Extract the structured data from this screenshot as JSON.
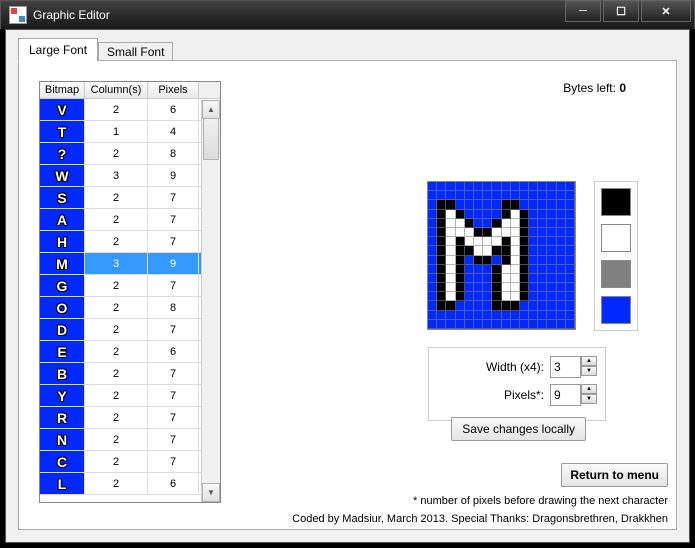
{
  "window": {
    "title": "Graphic Editor"
  },
  "tabs": {
    "large": "Large Font",
    "small": "Small Font"
  },
  "grid": {
    "headers": {
      "bitmap": "Bitmap",
      "columns": "Column(s)",
      "pixels": "Pixels"
    },
    "rows": [
      {
        "glyph": "V",
        "cols": "2",
        "px": "6"
      },
      {
        "glyph": "T",
        "cols": "1",
        "px": "4"
      },
      {
        "glyph": "?",
        "cols": "2",
        "px": "8"
      },
      {
        "glyph": "W",
        "cols": "3",
        "px": "9"
      },
      {
        "glyph": "S",
        "cols": "2",
        "px": "7"
      },
      {
        "glyph": "A",
        "cols": "2",
        "px": "7"
      },
      {
        "glyph": "H",
        "cols": "2",
        "px": "7"
      },
      {
        "glyph": "M",
        "cols": "3",
        "px": "9"
      },
      {
        "glyph": "G",
        "cols": "2",
        "px": "7"
      },
      {
        "glyph": "O",
        "cols": "2",
        "px": "8"
      },
      {
        "glyph": "D",
        "cols": "2",
        "px": "7"
      },
      {
        "glyph": "E",
        "cols": "2",
        "px": "6"
      },
      {
        "glyph": "B",
        "cols": "2",
        "px": "7"
      },
      {
        "glyph": "Y",
        "cols": "2",
        "px": "7"
      },
      {
        "glyph": "R",
        "cols": "2",
        "px": "7"
      },
      {
        "glyph": "N",
        "cols": "2",
        "px": "7"
      },
      {
        "glyph": "C",
        "cols": "2",
        "px": "7"
      },
      {
        "glyph": "L",
        "cols": "2",
        "px": "6"
      }
    ],
    "selected_index": 7
  },
  "bytes_left": {
    "label": "Bytes left: ",
    "value": "0"
  },
  "palette": {
    "colors": [
      "black",
      "white",
      "gray",
      "blue"
    ]
  },
  "controls": {
    "width_label": "Width (x4):",
    "width_value": "3",
    "pixels_label": "Pixels*:",
    "pixels_value": "9",
    "save": "Save changes locally"
  },
  "return_label": "Return to menu",
  "footnote": "* number of pixels before drawing the next character",
  "credits": "Coded by Madsiur, March 2013. Special Thanks: Dragonsbrethren, Drakkhen",
  "chart_data": {
    "type": "bitmap",
    "width": 16,
    "height": 16,
    "legend": {
      "l": "blue",
      "b": "black",
      "w": "white"
    },
    "pixels": [
      "llllllllllllllll",
      "llllllllllllllll",
      "lbblllllbblllllll",
      "lbwbllllbwblllll",
      "lbwwbllbwwblllll",
      "lbwwwbbwwwblllll",
      "lbwbwwwwbwblllll",
      "lbwbbwwbbwblllll",
      "lbwblbblbwblllll",
      "lbwblllbwwblllll",
      "lbwblllbwwblllll",
      "lbwblllbwwblllll",
      "lbwblllbwwblllll",
      "lbbllllbbblllllll",
      "llllllllllllllll",
      "llllllllllllllll"
    ]
  }
}
